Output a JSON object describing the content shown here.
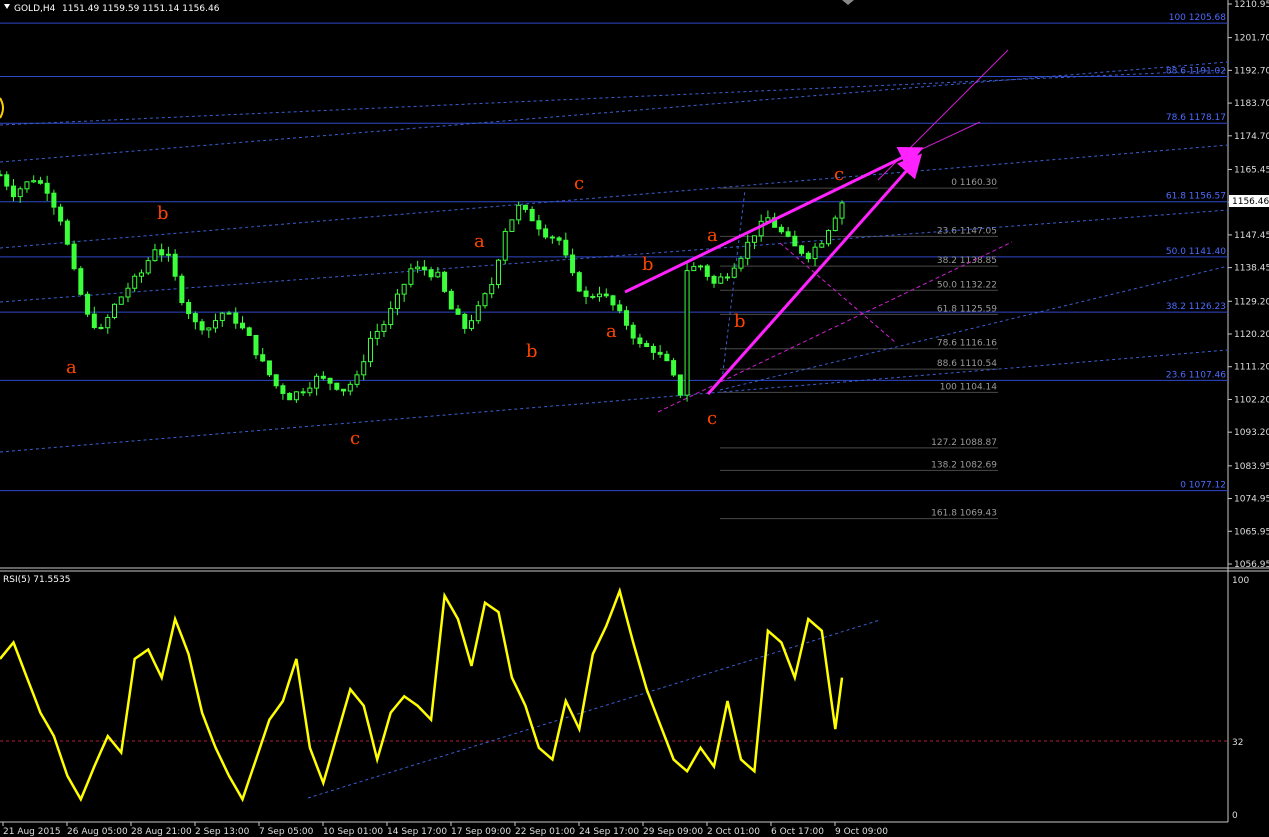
{
  "header": {
    "symbol_label": "GOLD,H4",
    "ohlc": "1151.49 1159.59 1151.14 1156.46"
  },
  "chart_data": [
    {
      "type": "candlestick",
      "ylim": [
        1056.95,
        1210.95
      ],
      "y_ticks": [
        "1210.95",
        "1201.70",
        "1192.70",
        "1183.70",
        "1174.70",
        "1165.45",
        "1156.46",
        "1147.45",
        "1138.45",
        "1129.20",
        "1120.20",
        "1111.20",
        "1102.20",
        "1093.20",
        "1083.95",
        "1074.95",
        "1065.95",
        "1056.95"
      ],
      "current_price": "1156.46",
      "x_ticks": [
        "21 Aug 2015",
        "26 Aug 05:00",
        "28 Aug 21:00",
        "2 Sep 13:00",
        "7 Sep 05:00",
        "10 Sep 01:00",
        "14 Sep 17:00",
        "17 Sep 09:00",
        "22 Sep 01:00",
        "24 Sep 17:00",
        "29 Sep 09:00",
        "2 Oct 01:00",
        "6 Oct 17:00",
        "9 Oct 09:00"
      ],
      "close_path": [
        [
          0,
          1164
        ],
        [
          2,
          1159
        ],
        [
          5,
          1163
        ],
        [
          7,
          1160
        ],
        [
          9,
          1152
        ],
        [
          11,
          1137
        ],
        [
          13,
          1125
        ],
        [
          15,
          1121
        ],
        [
          17,
          1128
        ],
        [
          19,
          1133
        ],
        [
          21,
          1137
        ],
        [
          23,
          1144
        ],
        [
          25,
          1141
        ],
        [
          27,
          1130
        ],
        [
          29,
          1123
        ],
        [
          31,
          1122
        ],
        [
          33,
          1126
        ],
        [
          35,
          1124
        ],
        [
          37,
          1119
        ],
        [
          39,
          1112
        ],
        [
          41,
          1106
        ],
        [
          43,
          1103
        ],
        [
          45,
          1105
        ],
        [
          47,
          1108
        ],
        [
          49,
          1107
        ],
        [
          51,
          1105
        ],
        [
          53,
          1108
        ],
        [
          55,
          1119
        ],
        [
          57,
          1123
        ],
        [
          59,
          1130
        ],
        [
          61,
          1138
        ],
        [
          63,
          1138
        ],
        [
          65,
          1136
        ],
        [
          67,
          1127
        ],
        [
          69,
          1122
        ],
        [
          71,
          1127
        ],
        [
          73,
          1134
        ],
        [
          75,
          1149
        ],
        [
          77,
          1155
        ],
        [
          79,
          1152
        ],
        [
          81,
          1148
        ],
        [
          83,
          1146
        ],
        [
          85,
          1136
        ],
        [
          87,
          1130
        ],
        [
          89,
          1132
        ],
        [
          91,
          1128
        ],
        [
          93,
          1123
        ],
        [
          95,
          1117
        ],
        [
          97,
          1116
        ],
        [
          99,
          1112
        ],
        [
          101,
          1104
        ],
        [
          102,
          1138
        ],
        [
          104,
          1139
        ],
        [
          106,
          1134
        ],
        [
          108,
          1137
        ],
        [
          110,
          1142
        ],
        [
          112,
          1148
        ],
        [
          114,
          1152
        ],
        [
          116,
          1148
        ],
        [
          118,
          1144
        ],
        [
          120,
          1142
        ],
        [
          122,
          1146
        ],
        [
          124,
          1153
        ],
        [
          125,
          1156.46
        ]
      ],
      "fib_right": [
        {
          "label": "100 1205.68",
          "value": 1205.68
        },
        {
          "label": "88.6 1191.02",
          "value": 1191.02
        },
        {
          "label": "78.6 1178.17",
          "value": 1178.17
        },
        {
          "label": "61.8 1156.57",
          "value": 1156.57
        },
        {
          "label": "50.0 1141.40",
          "value": 1141.4
        },
        {
          "label": "38.2 1126.23",
          "value": 1126.23
        },
        {
          "label": "23.6 1107.46",
          "value": 1107.46
        },
        {
          "label": "0 1077.12",
          "value": 1077.12
        }
      ],
      "fib_mid": [
        {
          "label": "0 1160.30",
          "value": 1160.3
        },
        {
          "label": "23.6 1147.05",
          "value": 1147.05
        },
        {
          "label": "38.2 1138.85",
          "value": 1138.85
        },
        {
          "label": "50.0 1132.22",
          "value": 1132.22
        },
        {
          "label": "61.8 1125.59",
          "value": 1125.59
        },
        {
          "label": "78.6 1116.16",
          "value": 1116.16
        },
        {
          "label": "88.6 1110.54",
          "value": 1110.54
        },
        {
          "label": "100 1104.14",
          "value": 1104.14
        },
        {
          "label": "127.2 1088.87",
          "value": 1088.87
        },
        {
          "label": "138.2 1082.69",
          "value": 1082.69
        },
        {
          "label": "161.8 1069.43",
          "value": 1069.43
        }
      ],
      "wave_labels": [
        "a",
        "b",
        "c",
        "a",
        "b",
        "c",
        "a",
        "b",
        "c",
        "a",
        "b",
        "c"
      ]
    },
    {
      "type": "line",
      "title": "RSI(5) 71.5535",
      "ylim": [
        0,
        100
      ],
      "y_ticks": [
        "100",
        "32",
        "0"
      ],
      "level": 32,
      "path": [
        [
          0,
          68
        ],
        [
          2,
          75
        ],
        [
          4,
          60
        ],
        [
          6,
          45
        ],
        [
          8,
          35
        ],
        [
          10,
          18
        ],
        [
          12,
          8
        ],
        [
          14,
          22
        ],
        [
          16,
          35
        ],
        [
          18,
          28
        ],
        [
          20,
          68
        ],
        [
          22,
          72
        ],
        [
          24,
          60
        ],
        [
          26,
          85
        ],
        [
          28,
          70
        ],
        [
          30,
          45
        ],
        [
          32,
          30
        ],
        [
          34,
          18
        ],
        [
          36,
          8
        ],
        [
          38,
          25
        ],
        [
          40,
          42
        ],
        [
          42,
          50
        ],
        [
          44,
          68
        ],
        [
          46,
          30
        ],
        [
          48,
          15
        ],
        [
          50,
          35
        ],
        [
          52,
          55
        ],
        [
          54,
          48
        ],
        [
          56,
          25
        ],
        [
          58,
          45
        ],
        [
          60,
          52
        ],
        [
          62,
          48
        ],
        [
          64,
          42
        ],
        [
          66,
          95
        ],
        [
          68,
          85
        ],
        [
          70,
          65
        ],
        [
          72,
          92
        ],
        [
          74,
          88
        ],
        [
          76,
          60
        ],
        [
          78,
          48
        ],
        [
          80,
          30
        ],
        [
          82,
          25
        ],
        [
          84,
          50
        ],
        [
          86,
          38
        ],
        [
          88,
          70
        ],
        [
          90,
          82
        ],
        [
          92,
          97
        ],
        [
          94,
          75
        ],
        [
          96,
          55
        ],
        [
          98,
          40
        ],
        [
          100,
          25
        ],
        [
          102,
          20
        ],
        [
          104,
          30
        ],
        [
          106,
          22
        ],
        [
          108,
          50
        ],
        [
          110,
          25
        ],
        [
          112,
          20
        ],
        [
          114,
          80
        ],
        [
          116,
          75
        ],
        [
          118,
          60
        ],
        [
          120,
          85
        ],
        [
          122,
          80
        ],
        [
          124,
          38
        ],
        [
          125,
          60
        ]
      ]
    }
  ]
}
